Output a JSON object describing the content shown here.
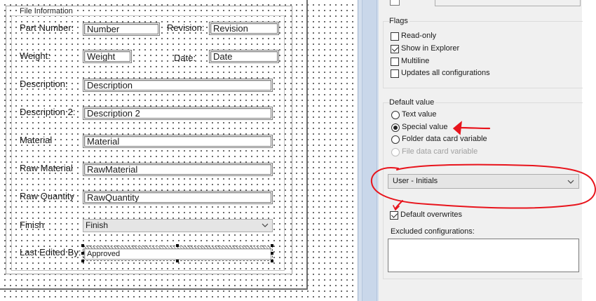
{
  "form": {
    "group_title": "File Information",
    "fields": [
      {
        "label": "Part Number:",
        "value": "Number"
      },
      {
        "label": "Revision:",
        "value": "Revision"
      },
      {
        "label": "Weight:",
        "value": "Weight"
      },
      {
        "label": "Date:",
        "value": "Date"
      },
      {
        "label": "Description:",
        "value": "Description"
      },
      {
        "label": "Description 2:",
        "value": "Description 2"
      },
      {
        "label": "Material",
        "value": "Material"
      },
      {
        "label": "Raw Material",
        "value": "RawMaterial"
      },
      {
        "label": "Raw Quantity",
        "value": "RawQuantity"
      },
      {
        "label": "Finish",
        "value": "Finish"
      },
      {
        "label": "Last Edited By:",
        "value": "Approved"
      }
    ]
  },
  "panel": {
    "flags": {
      "title": "Flags",
      "items": [
        {
          "label": "Read-only",
          "checked": false
        },
        {
          "label": "Show in Explorer",
          "checked": true
        },
        {
          "label": "Multiline",
          "checked": false
        },
        {
          "label": "Updates all configurations",
          "checked": false
        }
      ]
    },
    "default_value": {
      "title": "Default value",
      "options": [
        {
          "label": "Text value",
          "selected": false,
          "enabled": true
        },
        {
          "label": "Special value",
          "selected": true,
          "enabled": true
        },
        {
          "label": "Folder data card variable",
          "selected": false,
          "enabled": true
        },
        {
          "label": "File data card variable",
          "selected": false,
          "enabled": false
        }
      ],
      "special_value_select": "User - Initials",
      "default_overwrites": {
        "label": "Default overwrites",
        "checked": true
      }
    },
    "excluded": {
      "title": "Excluded configurations:"
    }
  },
  "colors": {
    "annotation": "#e8141c",
    "divider": "#d4dfee",
    "panel_bg": "#f0f0f0"
  }
}
